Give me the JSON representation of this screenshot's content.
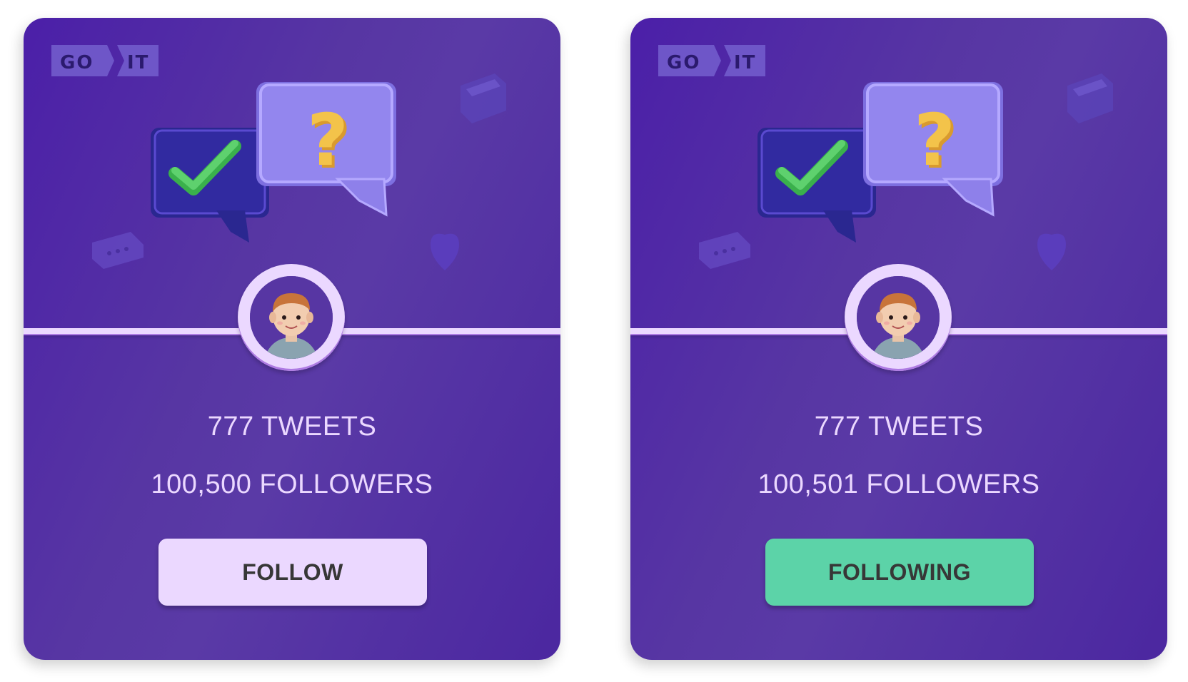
{
  "logo": {
    "part1": "GO",
    "part2": "IT"
  },
  "cards": [
    {
      "tweets": "777 TWEETS",
      "followers": "100,500 FOLLOWERS",
      "button_label": "FOLLOW",
      "button_color": "#ebd8ff"
    },
    {
      "tweets": "777 TWEETS",
      "followers": "100,501 FOLLOWERS",
      "button_label": "FOLLOWING",
      "button_color": "#5cd3a8"
    }
  ],
  "colors": {
    "card_bg": "#5736a3",
    "text": "#ebd8ff",
    "button_text": "#373737",
    "question_mark": "#f3c34a",
    "check": "#4cc35c"
  }
}
